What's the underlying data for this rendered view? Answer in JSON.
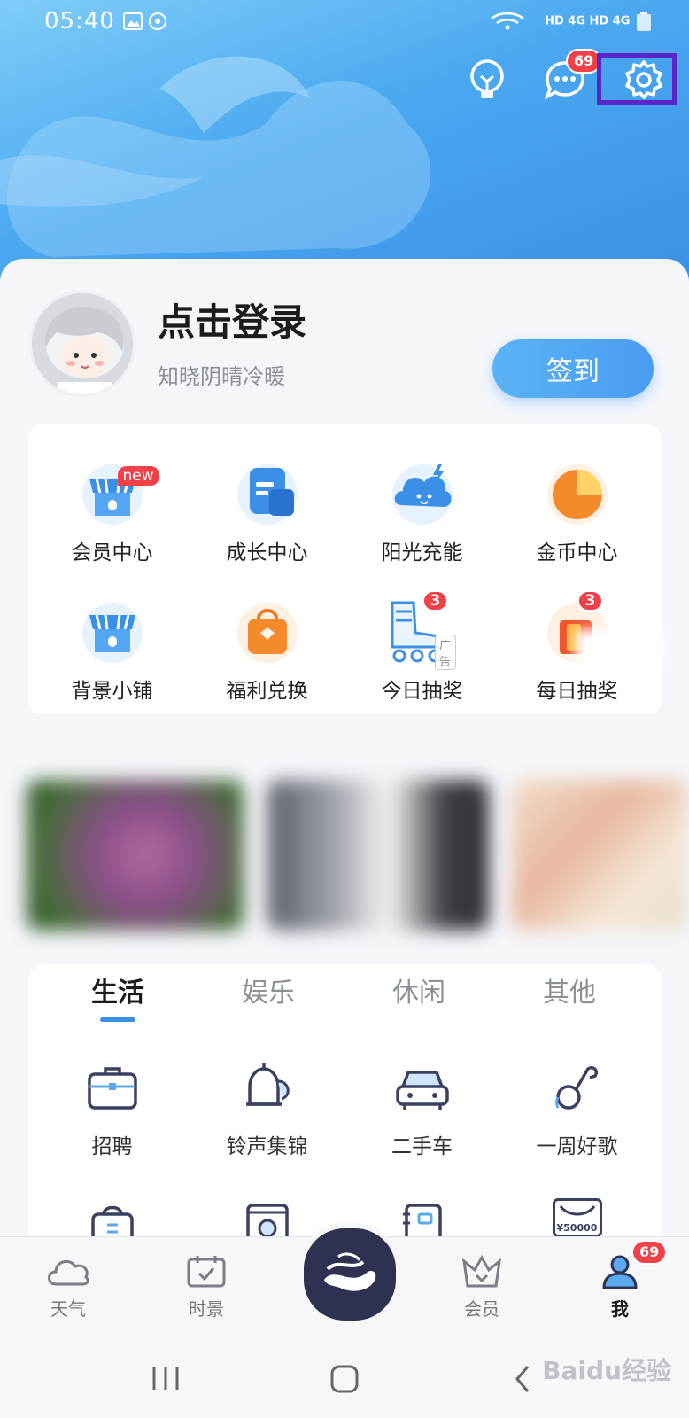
{
  "status_bar": {
    "time": "05:40",
    "right_text": "HD 4G HD 4G"
  },
  "header": {
    "messages_badge": "69"
  },
  "profile": {
    "title": "点击登录",
    "subtitle": "知晓阴晴冷暖",
    "signin_label": "签到"
  },
  "features": [
    {
      "label": "会员中心",
      "icon": "store-icon",
      "tag": "new"
    },
    {
      "label": "成长中心",
      "icon": "document-icon"
    },
    {
      "label": "阳光充能",
      "icon": "cloud-face-icon"
    },
    {
      "label": "金币中心",
      "icon": "pie-icon"
    },
    {
      "label": "背景小铺",
      "icon": "store-icon"
    },
    {
      "label": "福利兑换",
      "icon": "shopping-bag-icon"
    },
    {
      "label": "今日抽奖",
      "icon": "roller-skate-icon",
      "badge": "3",
      "tag": "广告"
    },
    {
      "label": "每日抽奖",
      "icon": "gift-icon",
      "badge": "3"
    }
  ],
  "tabs": [
    {
      "label": "生活",
      "active": true
    },
    {
      "label": "娱乐"
    },
    {
      "label": "休闲"
    },
    {
      "label": "其他"
    }
  ],
  "services": [
    {
      "label": "招聘",
      "icon": "briefcase-icon"
    },
    {
      "label": "铃声集锦",
      "icon": "bell-icon"
    },
    {
      "label": "二手车",
      "icon": "car-icon"
    },
    {
      "label": "一周好歌",
      "icon": "music-note-icon"
    }
  ],
  "services_row2_partial": [
    {
      "icon": "bag-icon"
    },
    {
      "icon": "washer-icon"
    },
    {
      "icon": "phone-book-icon"
    },
    {
      "icon": "coupon-icon",
      "text": "¥50000"
    }
  ],
  "bottom_nav": [
    {
      "label": "天气",
      "icon": "cloud-icon"
    },
    {
      "label": "时景",
      "icon": "calendar-icon"
    },
    {
      "label": "会员",
      "icon": "crown-icon"
    },
    {
      "label": "我",
      "icon": "user-icon",
      "badge": "69",
      "active": true
    }
  ],
  "watermark": "Baidu经验",
  "colors": {
    "accent": "#3b8fe6",
    "badge": "#f0404a",
    "highlight_frame": "#5a26c9"
  }
}
